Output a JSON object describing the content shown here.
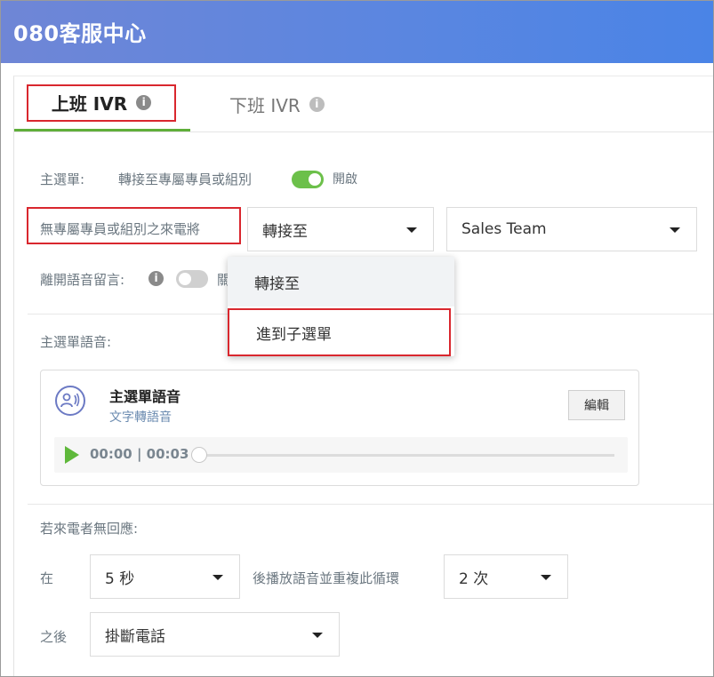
{
  "app": {
    "title": "080客服中心"
  },
  "tabs": [
    {
      "label": "上班 IVR",
      "active": true
    },
    {
      "label": "下班 IVR",
      "active": false
    }
  ],
  "main_menu": {
    "label": "主選單:",
    "transfer_label": "轉接至專屬專員或組別",
    "toggle_on_label": "開啟",
    "toggle_state": true
  },
  "no_agent": {
    "label": "無專屬專員或組別之來電將",
    "action_value": "轉接至",
    "target_value": "Sales Team"
  },
  "dropdown": {
    "options": [
      "轉接至",
      "進到子選單"
    ]
  },
  "voicemail": {
    "label": "離開語音留言:",
    "toggle_label_partial": "關",
    "toggle_state": false
  },
  "menu_voice": {
    "section_label": "主選單語音:",
    "card_title": "主選單語音",
    "card_subtitle": "文字轉語音",
    "edit_label": "編輯",
    "time": "00:00 | 00:03",
    "progress": 0
  },
  "no_response": {
    "section_label": "若來電者無回應:",
    "in_label": "在",
    "seconds_value": "5 秒",
    "replay_label": "後播放語音並重複此循環",
    "repeat_value": "2 次",
    "after_label": "之後",
    "after_value": "掛斷電話"
  },
  "colors": {
    "header_start": "#6f86d6",
    "header_end": "#4a84e6",
    "accent_green": "#6cc04a",
    "highlight_red": "#d9272e"
  }
}
